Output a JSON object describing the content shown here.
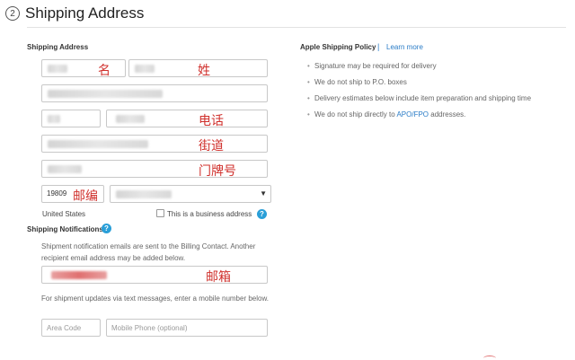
{
  "header": {
    "step_number": "2",
    "title": "Shipping Address"
  },
  "form": {
    "section_label": "Shipping Address",
    "annotations": {
      "first_name": "名",
      "last_name": "姓",
      "phone": "电话",
      "street": "街道",
      "house_number": "门牌号",
      "postal_code": "邮编",
      "email": "邮箱"
    },
    "postal_code_value": "19809",
    "country": "United States",
    "business_checkbox_label": "This is a business address",
    "business_checked": false
  },
  "notifications": {
    "label": "Shipping Notifications",
    "email_note": "Shipment notification emails are sent to the Billing Contact. Another recipient email address may be added below.",
    "sms_note": "For shipment updates via text messages, enter a mobile number below.",
    "area_code_placeholder": "Area Code",
    "mobile_placeholder": "Mobile Phone (optional)"
  },
  "policy": {
    "title": "Apple Shipping Policy",
    "separator": "|",
    "learn_more": "Learn more",
    "items": [
      "Signature may be required for delivery",
      "We do not ship to P.O. boxes",
      "Delivery estimates below include item preparation and shipping time"
    ],
    "last_item_prefix": "We do not ship directly to ",
    "last_item_link": "APO/FPO",
    "last_item_suffix": " addresses."
  },
  "colors": {
    "annotation": "#d0312d",
    "link": "#2a7cc7",
    "help": "#2a9fd8"
  }
}
